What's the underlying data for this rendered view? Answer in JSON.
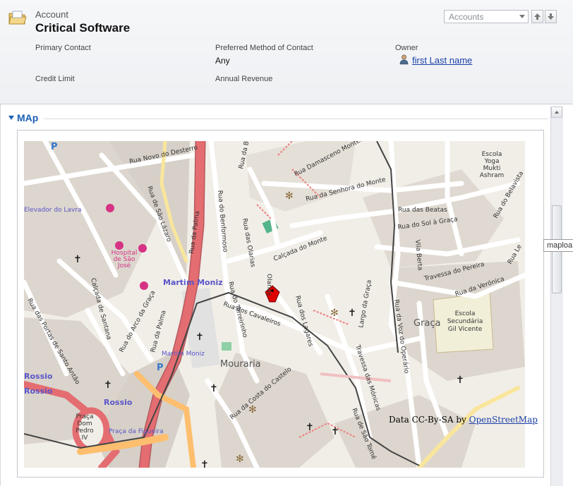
{
  "header": {
    "entity_type": "Account",
    "record_name": "Critical Software",
    "form_selector": "Accounts",
    "fields": {
      "primary_contact_label": "Primary Contact",
      "preferred_method_label": "Preferred Method of Contact",
      "preferred_method_value": "Any",
      "owner_label": "Owner",
      "owner_value": "first Last name",
      "credit_limit_label": "Credit Limit",
      "annual_revenue_label": "Annual Revenue"
    }
  },
  "section": {
    "title": "MAp"
  },
  "tooltip": "maploa",
  "map": {
    "attribution_prefix": "Data CC-By-SA by ",
    "attribution_link": "OpenStreetMap",
    "labels": {
      "rua_novo_desterro": "Rua Novo do Desterro",
      "rua_bombarda": "Rua da Bombarda",
      "rua_damasceno_monteiro": "Rua Damasceno Monteiro",
      "escola_yoga": "Escola",
      "escola_yoga_2": "Yoga",
      "escola_yoga_3": "Mukti",
      "escola_yoga_4": "Ashram",
      "rua_senhora_monte": "Rua da Senhora do Monte",
      "rua_beatas": "Rua das Beatas",
      "rua_sol_graca": "Rua do Sol à Graça",
      "rua_belavista": "Rua do Belavista",
      "elevador_lavra": "Elevador do Lavra",
      "rua_sao_lazaro": "Rua de São Lázaro",
      "rua_palma": "Rua da Palma",
      "rua_benformoso": "Rua do Benformoso",
      "rua_olarias": "Rua das Olarias",
      "calcada_monte": "Calçada do Monte",
      "vila_berta": "Vila Berta",
      "travessa_pereira": "Travessa do Pereira",
      "rua_le": "Rua Le",
      "hospital_1": "Hospital",
      "hospital_2": "de São",
      "hospital_3": "José",
      "martim_moniz": "Martim Moniz",
      "martim_moniz_station": "Martim Moniz",
      "rua_terreirinho": "Rua do Terreirinho",
      "rua_olarias_small": "Olarias",
      "rua_lagares": "Rua dos Lagares",
      "largo_graca": "Largo da Graça",
      "rua_voz_operario": "Rua da Voz do Operário",
      "rua_veronica": "Rua da Verónica",
      "escola_sec_1": "Escola",
      "escola_sec_2": "Secundária",
      "escola_sec_3": "Gil Vicente",
      "graca": "Graça",
      "calcada_santana": "Calçada de Santana",
      "rua_portas_santo_antao": "Rua das Portas de Santo Antão",
      "rua_arco_graca": "Rua do Arco da Graça",
      "rua_cavaleiros": "Rua dos Cavaleiros",
      "mouraria": "Mouraria",
      "travessa_monicas": "Travessa das Mónicas",
      "rossio_1": "Rossio",
      "rossio_2": "Rossio",
      "rossio_3": "Rossio",
      "rua_costa_castelo": "Rua da Costa do Castelo",
      "praca_dom_pedro_1": "Praça",
      "praca_dom_pedro_2": "Dom",
      "praca_dom_pedro_3": "Pedro",
      "praca_dom_pedro_4": "IV",
      "praca_figueira": "Praça da Figueira",
      "rua_sao_tome": "Rua de São Tomé"
    }
  },
  "colors": {
    "section_blue": "#1b5fb5",
    "link_blue": "#1a3fa8",
    "map_land": "#f1eee8",
    "map_primary_road": "#e46d71",
    "map_secondary_road": "#fdbf6f",
    "map_poi_label": "#7b68c8"
  }
}
